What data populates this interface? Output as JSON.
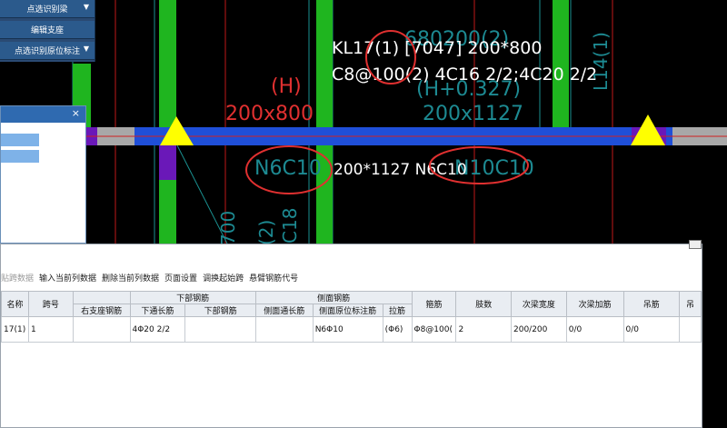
{
  "toolbar": {
    "buttons": [
      {
        "label": "点选识别梁",
        "has_dropdown": true
      },
      {
        "label": "编辑支座",
        "has_dropdown": false
      },
      {
        "label": "点选识别原位标注",
        "has_dropdown": true
      }
    ]
  },
  "panel": {
    "close_icon": "×"
  },
  "canvas": {
    "beam_label_line1": "KL17(1) [7047] 200*800",
    "beam_label_line2": "C8@100(2) 4C16 2/2;4C20 2/2",
    "label_H": "(H)",
    "label_200x800": "200x800",
    "label_N6C10_left": "N6C10",
    "label_200x1127_N6C10": "200*1127 N6C10",
    "label_N10C10": "N10C10",
    "label_H0327": "(H+0.327)",
    "label_200x1127": "200x1127",
    "label_KL_partial": "680200(2)",
    "label_L14": "L14(1)",
    "label_700": "700",
    "label_c2": "(2)",
    "label_c18": "C18",
    "colors": {
      "beam_blue": "#1f4fd8",
      "column_green": "#1fb51f",
      "support_yellow": "#ffff00",
      "annotation_red": "#e03030",
      "cyan_text": "#1d8a92"
    }
  },
  "datawin": {
    "menu": [
      "贴跨数据",
      "输入当前列数据",
      "删除当前列数据",
      "页面设置",
      "调换起始跨",
      "悬臂钢筋代号"
    ],
    "header_top": [
      "名称",
      "跨号",
      "",
      "下部钢筋",
      "侧面钢筋",
      "箍筋",
      "肢数",
      "次梁宽度",
      "次梁加筋",
      "吊筋",
      "吊"
    ],
    "header_sub": [
      "右支座钢筋",
      "下通长筋",
      "下部钢筋",
      "侧面通长筋",
      "侧面原位标注筋",
      "拉筋"
    ],
    "row": {
      "name": "17(1)",
      "span": "1",
      "right_support": "",
      "bottom_through": "4Φ20 2/2",
      "bottom_rebar": "",
      "side_through": "",
      "side_in_situ": "N6Φ10",
      "tie": "(Φ6)",
      "stirrup": "Φ8@100(",
      "legs": "2",
      "sec_beam_width": "200/200",
      "sec_beam_add": "0/0",
      "hanger": "0/0",
      "hanger2": ""
    }
  }
}
